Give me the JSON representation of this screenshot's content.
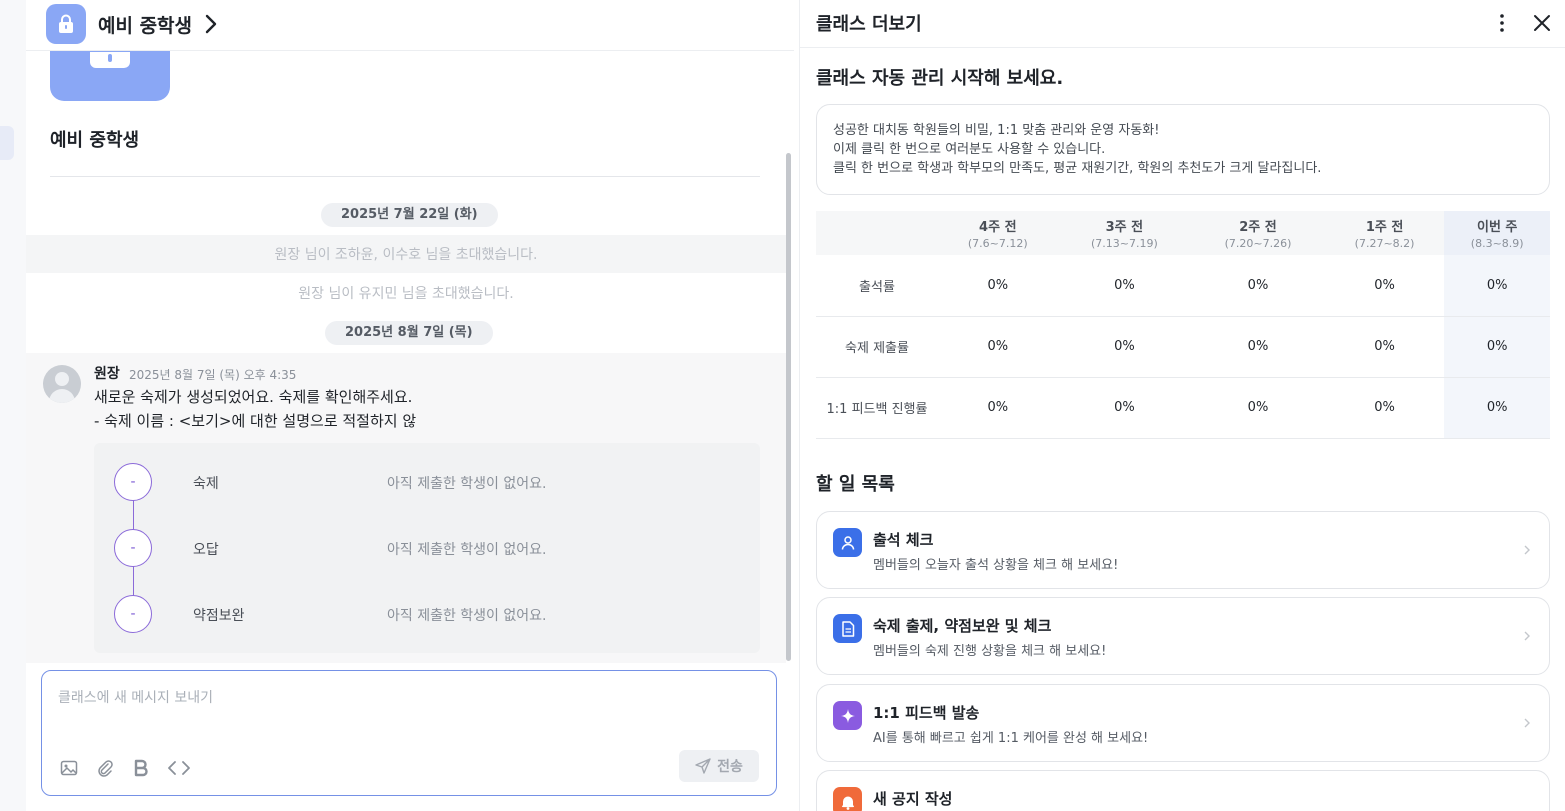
{
  "chat": {
    "header_title": "예비 중학생",
    "group_name": "예비 중학생",
    "dates": [
      "2025년 7월 22일 (화)",
      "2025년 8월 7일 (목)"
    ],
    "system_messages": [
      "원장 님이 조하윤, 이수호 님을 초대했습니다.",
      "원장 님이 유지민 님을 초대했습니다."
    ],
    "message": {
      "sender": "원장",
      "time": "2025년 8월 7일 (목) 오후 4:35",
      "line1": "새로운 숙제가 생성되었어요. 숙제를 확인해주세요.",
      "line2": "- 숙제 이름 : <보기>에 대한 설명으로 적절하지 않",
      "steps": [
        {
          "mark": "-",
          "name": "숙제",
          "status": "아직 제출한 학생이 없어요."
        },
        {
          "mark": "-",
          "name": "오답",
          "status": "아직 제출한 학생이 없어요."
        },
        {
          "mark": "-",
          "name": "약점보완",
          "status": "아직 제출한 학생이 없어요."
        }
      ]
    },
    "composer": {
      "placeholder": "클래스에 새 메시지 보내기",
      "send_label": "전송"
    }
  },
  "panel": {
    "title": "클래스 더보기",
    "auto_title": "클래스 자동 관리 시작해 보세요.",
    "intro_lines": [
      "성공한 대치동 학원들의 비밀, 1:1 맞춤 관리와 운영 자동화!",
      "이제 클릭 한 번으로 여러분도 사용할 수 있습니다.",
      "클릭 한 번으로 학생과 학부모의 만족도, 평균 재원기간, 학원의 추천도가 크게 달라집니다."
    ],
    "weeks": [
      {
        "label": "4주 전",
        "range": "(7.6~7.12)"
      },
      {
        "label": "3주 전",
        "range": "(7.13~7.19)"
      },
      {
        "label": "2주 전",
        "range": "(7.20~7.26)"
      },
      {
        "label": "1주 전",
        "range": "(7.27~8.2)"
      },
      {
        "label": "이번 주",
        "range": "(8.3~8.9)"
      }
    ],
    "metrics": [
      {
        "label": "출석률",
        "values": [
          "0%",
          "0%",
          "0%",
          "0%",
          "0%"
        ]
      },
      {
        "label": "숙제 제출률",
        "values": [
          "0%",
          "0%",
          "0%",
          "0%",
          "0%"
        ]
      },
      {
        "label": "1:1 피드백 진행률",
        "values": [
          "0%",
          "0%",
          "0%",
          "0%",
          "0%"
        ]
      }
    ],
    "todo_title": "할 일 목록",
    "todos": [
      {
        "icon": "person-icon",
        "color": "#3b6fe8",
        "name": "출석 체크",
        "desc": "멤버들의 오늘자 출석 상황을 체크 해 보세요!"
      },
      {
        "icon": "document-icon",
        "color": "#3b6fe8",
        "name": "숙제 출제, 약점보완 및 체크",
        "desc": "멤버들의 숙제 진행 상황을 체크 해 보세요!"
      },
      {
        "icon": "sparkle-icon",
        "color": "#8a5be0",
        "name": "1:1 피드백 발송",
        "desc": "AI를 통해 빠르고 쉽게 1:1 케어를 완성 해 보세요!"
      },
      {
        "icon": "bell-icon",
        "color": "#f06a3a",
        "name": "새 공지 작성",
        "desc": ""
      }
    ]
  },
  "colors": {
    "accent": "#8aa7f5",
    "composer_border": "#7591e6",
    "step_purple": "#8b6ad9"
  }
}
